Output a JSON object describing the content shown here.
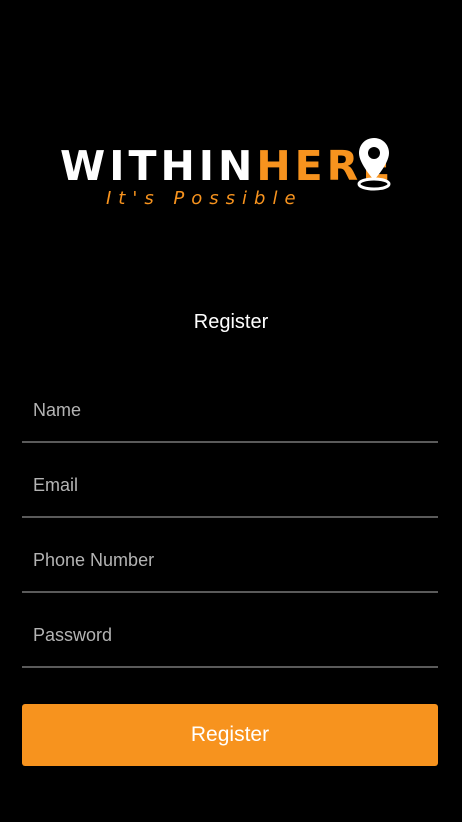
{
  "logo": {
    "brand_part_1": "WITHIN",
    "brand_part_2": "HERE",
    "tagline": "It's Possible",
    "pin_icon": "location-pin-icon",
    "accent_color": "#f7931e"
  },
  "form": {
    "title": "Register",
    "fields": {
      "name": {
        "placeholder": "Name",
        "value": ""
      },
      "email": {
        "placeholder": "Email",
        "value": ""
      },
      "phone": {
        "placeholder": "Phone Number",
        "value": ""
      },
      "password": {
        "placeholder": "Password",
        "value": ""
      }
    },
    "submit_label": "Register"
  },
  "colors": {
    "background": "#000000",
    "accent": "#f7931e",
    "divider": "#5a5a5a",
    "placeholder": "#b4b4b4"
  }
}
